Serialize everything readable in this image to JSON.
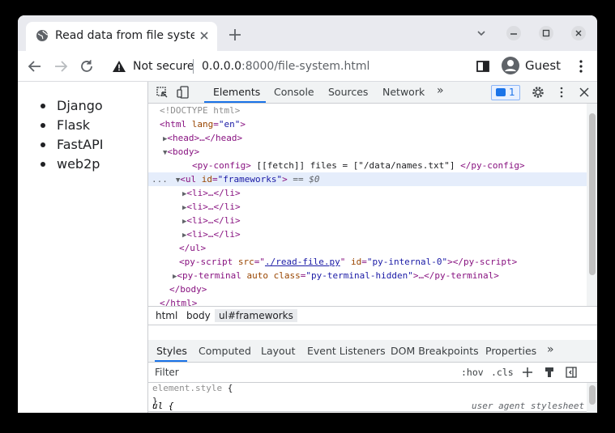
{
  "tab": {
    "title": "Read data from file system"
  },
  "toolbar": {
    "security": "Not secure",
    "url_host": "0.0.0.0",
    "url_rest": ":8000/file-system.html",
    "profile": "Guest"
  },
  "page": {
    "items": [
      "Django",
      "Flask",
      "FastAPI",
      "web2p"
    ]
  },
  "devtools": {
    "tabs": [
      "Elements",
      "Console",
      "Sources",
      "Network",
      "»"
    ],
    "message_count": "1",
    "dom": {
      "doctype": "<!DOCTYPE html>",
      "html_open_tag": "<html",
      "html_lang_attr": "lang",
      "html_lang_val": "\"en\"",
      "head": "<head>…</head>",
      "body_open": "<body>",
      "pyconfig_open": "<py-config>",
      "pyconfig_text": " [[fetch]] files = [\"/data/names.txt\"] ",
      "pyconfig_close": "</py-config>",
      "ul_open": "<ul",
      "ul_id_attr": "id",
      "ul_id_val": "\"frameworks\"",
      "ul_suffix": "== $0",
      "li": "<li>…</li>",
      "ul_close": "</ul>",
      "pyscript_open": "<py-script",
      "src_attr": "src",
      "src_val": "./read-file.py",
      "id_attr": "id",
      "id_val": "\"py-internal-0\"",
      "pyscript_close": "></py-script>",
      "pyterm_open": "<py-terminal",
      "pyterm_auto": "auto",
      "class_attr": "class",
      "class_val": "\"py-terminal-hidden\"",
      "pyterm_close": ">…</py-terminal>",
      "body_close": "</body>",
      "html_close": "</html>",
      "ellipsis": "..."
    },
    "breadcrumbs": [
      "html",
      "body",
      "ul#frameworks"
    ],
    "style_tabs": [
      "Styles",
      "Computed",
      "Layout",
      "Event Listeners",
      "DOM Breakpoints",
      "Properties",
      "»"
    ],
    "filter_placeholder": "Filter",
    "hov": ":hov",
    "cls": ".cls",
    "rule1_selector": "element.style",
    "rule1_open": " {",
    "rule1_close": "}",
    "rule2_selector": "ul {",
    "rule2_source": "user agent stylesheet"
  },
  "colors": {
    "accent": "#1a73e8",
    "tabstrip": "#e9eaef",
    "selection": "#e5edfb"
  },
  "icons": [
    "globe-icon",
    "close-icon",
    "plus-icon",
    "chevron-down-icon",
    "minimize-icon",
    "maximize-icon",
    "close-window-icon",
    "back-icon",
    "forward-icon",
    "reload-icon",
    "warning-icon",
    "sidepanel-icon",
    "avatar-icon",
    "kebab-menu-icon",
    "inspect-icon",
    "device-toggle-icon",
    "gear-icon",
    "new-style-rule-icon",
    "toggle-sidebar-icon"
  ]
}
